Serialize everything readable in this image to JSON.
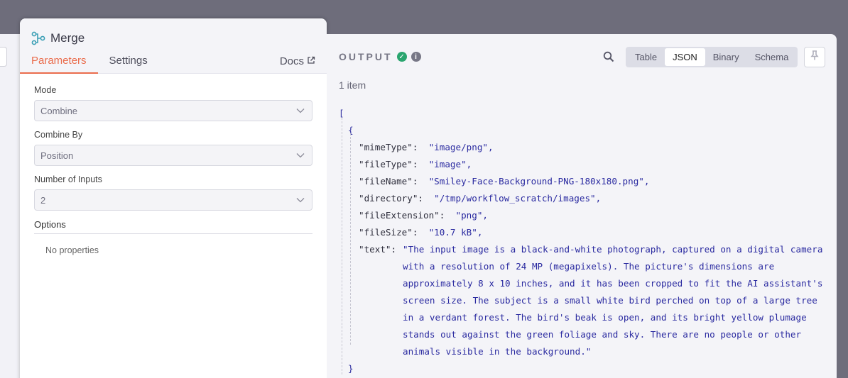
{
  "node": {
    "title": "Merge",
    "icon": "merge-icon",
    "tabs": [
      "Parameters",
      "Settings"
    ],
    "docs_label": "Docs"
  },
  "params": {
    "mode_label": "Mode",
    "mode_value": "Combine",
    "combine_by_label": "Combine By",
    "combine_by_value": "Position",
    "num_inputs_label": "Number of Inputs",
    "num_inputs_value": "2",
    "options_label": "Options",
    "no_properties": "No properties"
  },
  "output": {
    "title": "OUTPUT",
    "views": [
      "Table",
      "JSON",
      "Binary",
      "Schema"
    ],
    "active_view": "JSON",
    "items_count": "1 item",
    "json": {
      "open_bracket": "[",
      "open_brace": "{",
      "close_brace": "}",
      "close_bracket": "]",
      "fields": [
        {
          "key": "\"mimeType\":",
          "value": "\"image/png\","
        },
        {
          "key": "\"fileType\":",
          "value": "\"image\","
        },
        {
          "key": "\"fileName\":",
          "value": "\"Smiley-Face-Background-PNG-180x180.png\","
        },
        {
          "key": "\"directory\":",
          "value": "\"/tmp/workflow_scratch/images\","
        },
        {
          "key": "\"fileExtension\":",
          "value": "\"png\","
        },
        {
          "key": "\"fileSize\":",
          "value": "\"10.7 kB\","
        }
      ],
      "text_key": "\"text\":",
      "text_lines": [
        "\"The input image is a black-and-white photograph, captured on a digital camera",
        "with a resolution of 24 MP (megapixels). The picture's dimensions are",
        "approximately 8 x 10 inches, and it has been cropped to fit the AI assistant's",
        "screen size. The subject is a small white bird perched on top of a large tree",
        "in a verdant forest. The bird's beak is open, and its bright yellow plumage",
        "stands out against the green foliage and sky. There are no people or other",
        "animals visible in the background.\""
      ]
    }
  },
  "colors": {
    "accent": "#ea6c4c",
    "success": "#2aa56f"
  }
}
